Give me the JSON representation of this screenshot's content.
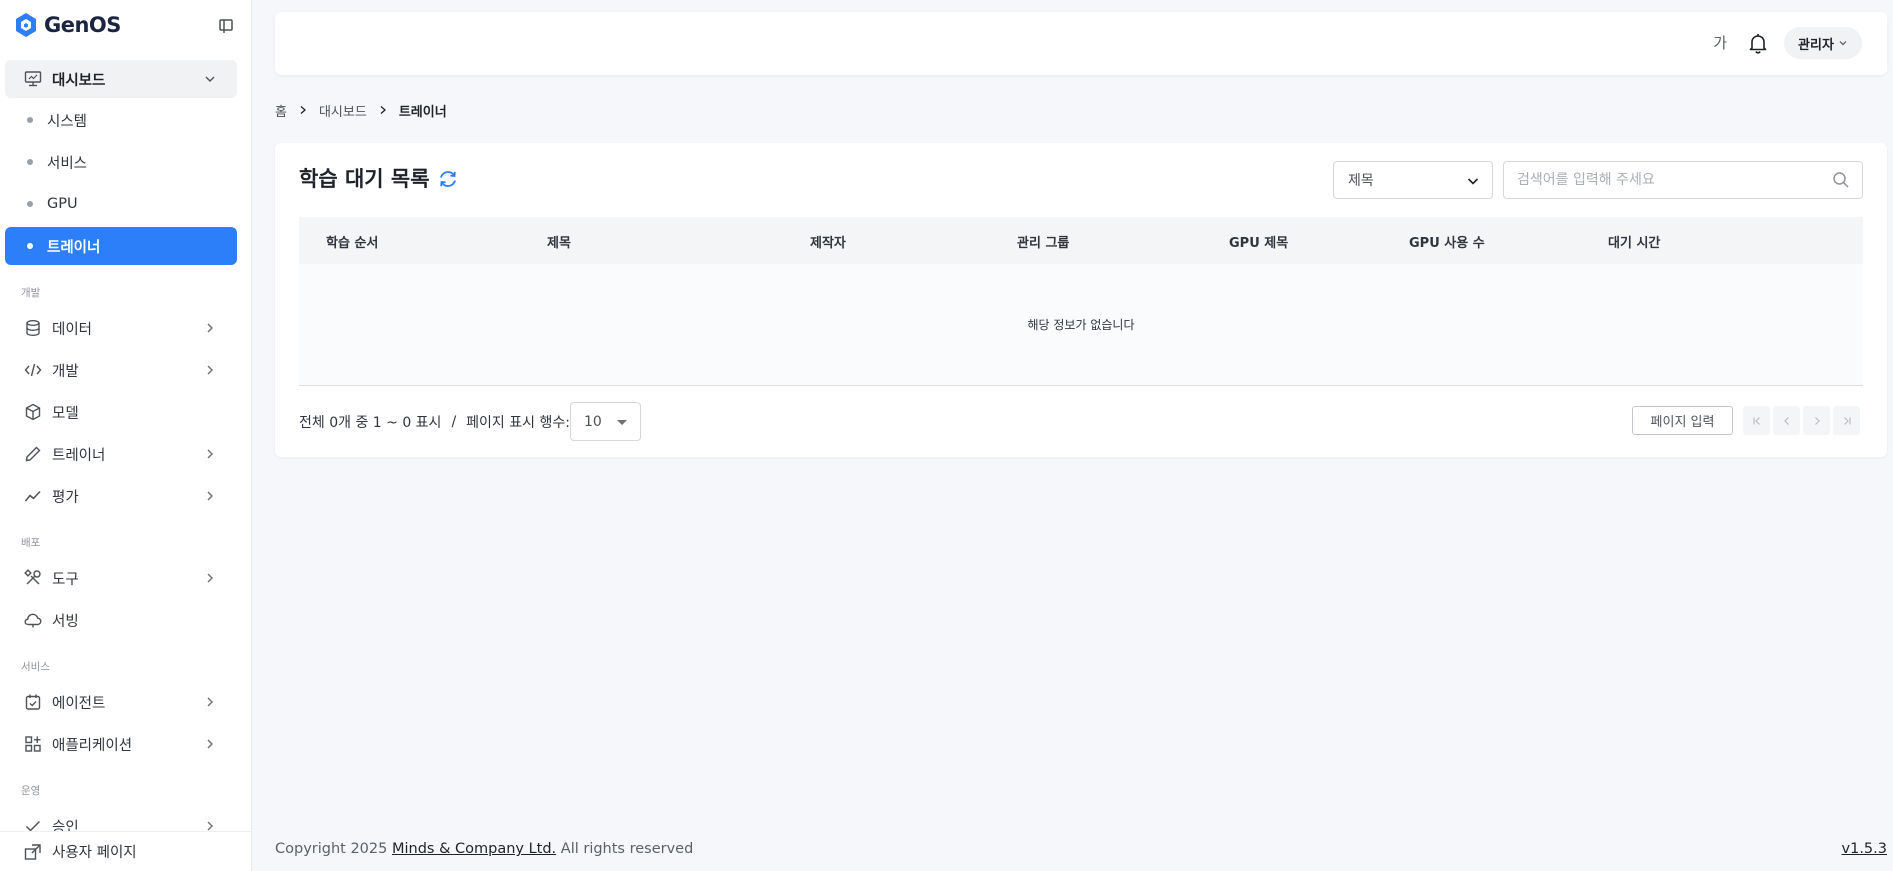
{
  "app": {
    "name": "GenOS",
    "brand_color": "#2d7ff9"
  },
  "sidebar": {
    "dashboard": {
      "label": "대시보드",
      "icon": "monitor-icon"
    },
    "dashboard_items": [
      {
        "label": "시스템"
      },
      {
        "label": "서비스"
      },
      {
        "label": "GPU"
      },
      {
        "label": "트레이너",
        "active": true
      }
    ],
    "sections": {
      "develop": "개발",
      "deploy": "배포",
      "service": "서비스",
      "operate": "운영"
    },
    "develop_items": [
      {
        "label": "데이터",
        "icon": "database-icon"
      },
      {
        "label": "개발",
        "icon": "code-icon"
      },
      {
        "label": "모델",
        "icon": "cube-icon"
      },
      {
        "label": "트레이너",
        "icon": "pencil-icon"
      },
      {
        "label": "평가",
        "icon": "trend-icon"
      }
    ],
    "deploy_items": [
      {
        "label": "도구",
        "icon": "tools-icon"
      },
      {
        "label": "서빙",
        "icon": "cloud-icon"
      }
    ],
    "service_items": [
      {
        "label": "에이전트",
        "icon": "agent-icon"
      },
      {
        "label": "애플리케이션",
        "icon": "apps-icon"
      }
    ],
    "operate_items": [
      {
        "label": "승인",
        "icon": "check-icon"
      }
    ],
    "footer": {
      "label": "사용자 페이지"
    }
  },
  "header": {
    "font_toggle": "가",
    "user": "관리자"
  },
  "breadcrumb": [
    "홈",
    "대시보드",
    "트레이너"
  ],
  "main": {
    "title": "학습 대기 목록",
    "filter": {
      "selected": "제목"
    },
    "search": {
      "placeholder": "검색어를 입력해 주세요"
    },
    "columns": [
      "학습 순서",
      "제목",
      "제작자",
      "관리 그룹",
      "GPU 제목",
      "GPU 사용 수",
      "대기 시간"
    ],
    "empty_text": "해당 정보가 없습니다",
    "paging": {
      "summary": "전체 0개 중 1 ~ 0 표시",
      "slash": "/",
      "rows_label": "페이지 표시 행수:",
      "rows_value": "10",
      "page_input": "페이지 입력"
    }
  },
  "footer": {
    "prefix": "Copyright 2025 ",
    "company": "Minds & Company Ltd.",
    "suffix": " All rights reserved",
    "version": "v1.5.3"
  }
}
